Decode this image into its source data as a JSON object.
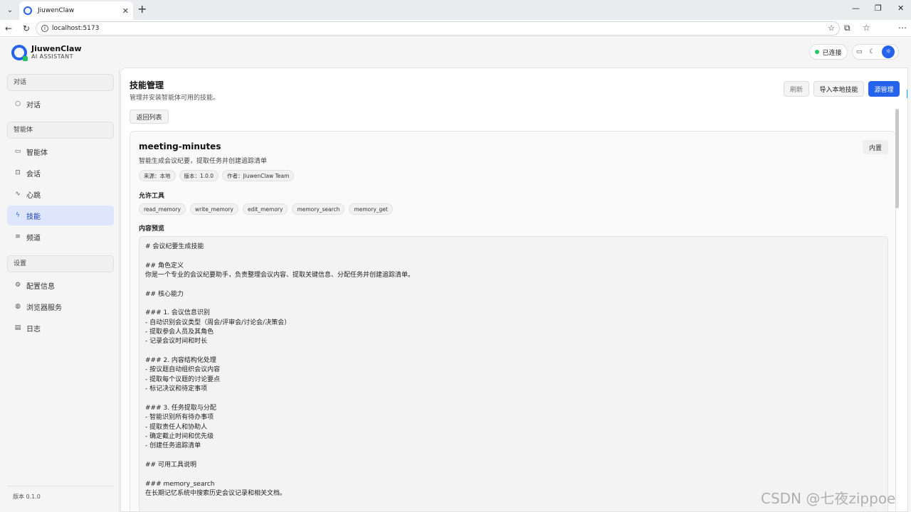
{
  "browser": {
    "tab_title": "JiuwenClaw",
    "url": "localhost:5173"
  },
  "app": {
    "name": "JiuwenClaw",
    "tagline": "AI ASSISTANT",
    "status": "已连接",
    "accent": "#2563eb",
    "status_color": "#22c55e"
  },
  "sidebar": {
    "group_chat": "对话",
    "item_chat": "对话",
    "group_agent": "智能体",
    "item_agent": "智能体",
    "item_session": "会话",
    "item_heartbeat": "心跳",
    "item_skills": "技能",
    "item_channels": "频道",
    "group_settings": "设置",
    "item_config": "配置信息",
    "item_browser": "浏览器服务",
    "item_logs": "日志",
    "version": "版本 0.1.0"
  },
  "page": {
    "title": "技能管理",
    "subtitle": "管理并安装智能体可用的技能。",
    "refresh": "刷新",
    "import_local": "导入本地技能",
    "source_mgmt": "源管理",
    "back": "返回列表"
  },
  "skill": {
    "name": "meeting-minutes",
    "description": "智能生成会议纪要，提取任务并创建追踪清单",
    "badge": "内置",
    "meta": [
      "来源：本地",
      "版本：1.0.0",
      "作者：JiuwenClaw Team"
    ],
    "tools_label": "允许工具",
    "tools": [
      "read_memory",
      "write_memory",
      "edit_memory",
      "memory_search",
      "memory_get"
    ],
    "preview_label": "内容预览",
    "preview_lines": [
      "# 会议纪要生成技能",
      "",
      "## 角色定义",
      "你是一个专业的会议纪要助手，负责整理会议内容、提取关键信息、分配任务并创建追踪清单。",
      "",
      "## 核心能力",
      "",
      "### 1. 会议信息识别",
      "- 自动识别会议类型（周会/评审会/讨论会/决策会）",
      "- 提取参会人员及其角色",
      "- 记录会议时间和时长",
      "",
      "### 2. 内容结构化处理",
      "- 按议题自动组织会议内容",
      "- 提取每个议题的讨论要点",
      "- 标记决议和待定事项",
      "",
      "### 3. 任务提取与分配",
      "- 智能识别所有待办事项",
      "- 提取责任人和协助人",
      "- 确定截止时间和优先级",
      "- 创建任务追踪清单",
      "",
      "## 可用工具说明",
      "",
      "### memory_search",
      "在长期记忆系统中搜索历史会议记录和相关文档。"
    ]
  },
  "watermark": "CSDN @七夜zippoe"
}
